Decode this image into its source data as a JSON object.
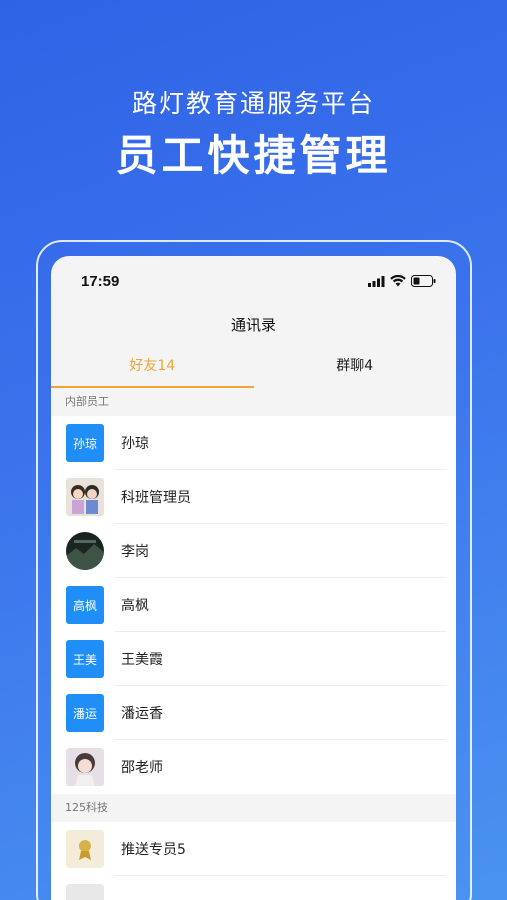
{
  "promo": {
    "subtitle": "路灯教育通服务平台",
    "title": "员工快捷管理"
  },
  "status_bar": {
    "time": "17:59"
  },
  "header": {
    "title": "通讯录"
  },
  "tabs": [
    {
      "label": "好友14",
      "active": true
    },
    {
      "label": "群聊4",
      "active": false
    }
  ],
  "sections": [
    {
      "title": "内部员工",
      "contacts": [
        {
          "name": "孙琼",
          "avatar_text": "孙琼"
        },
        {
          "name": "科班管理员"
        },
        {
          "name": "李岗"
        },
        {
          "name": "高枫",
          "avatar_text": "高枫"
        },
        {
          "name": "王美霞",
          "avatar_text": "王美"
        },
        {
          "name": "潘运香",
          "avatar_text": "潘运"
        },
        {
          "name": "邵老师"
        }
      ]
    },
    {
      "title": "125科技",
      "contacts": [
        {
          "name": "推送专员5"
        }
      ]
    }
  ],
  "colors": {
    "accent": "#f0a53a",
    "avatar_blue": "#1f8ef7",
    "background_gradient_start": "#2f63e6",
    "background_gradient_end": "#4a93f0"
  }
}
